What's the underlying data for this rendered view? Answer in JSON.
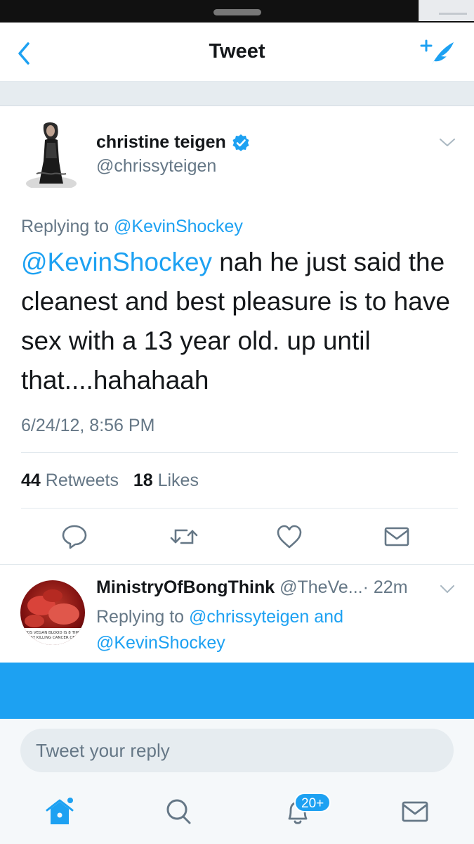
{
  "nav": {
    "title": "Tweet",
    "back_icon": "chevron-left-icon",
    "compose_icon": "compose-feather-icon"
  },
  "tweet": {
    "author_name": "christine teigen",
    "author_handle": "@chrissyteigen",
    "verified": true,
    "replying_prefix": "Replying to ",
    "replying_to": "@KevinShockey",
    "mention": "@KevinShockey",
    "text": " nah he just said the cleanest and best pleasure is to have sex with a 13 year old. up until that....hahahaah",
    "timestamp": "6/24/12, 8:56 PM",
    "retweets_count": "44",
    "retweets_label": "Retweets",
    "likes_count": "18",
    "likes_label": "Likes"
  },
  "reply": {
    "author_name": "MinistryOfBongThink",
    "author_handle": "@TheVe...",
    "time": "· 22m",
    "replying_prefix": "Replying to ",
    "replying_to_1": "@chrissyteigen",
    "and": " and",
    "replying_to_2": "@KevinShockey",
    "avatar_caption_1": "NDS VEGAN BLOOD IS 8 TIME",
    "avatar_caption_2": "AT KILLING CANCER CE"
  },
  "composer": {
    "placeholder": "Tweet your reply"
  },
  "tabbar": {
    "home_icon": "home-icon",
    "search_icon": "search-icon",
    "notifications_icon": "bell-icon",
    "notifications_badge": "20+",
    "messages_icon": "envelope-icon"
  },
  "colors": {
    "accent": "#1da1f2",
    "text": "#14171a",
    "secondary": "#657786",
    "divider": "#e1e8ed"
  }
}
